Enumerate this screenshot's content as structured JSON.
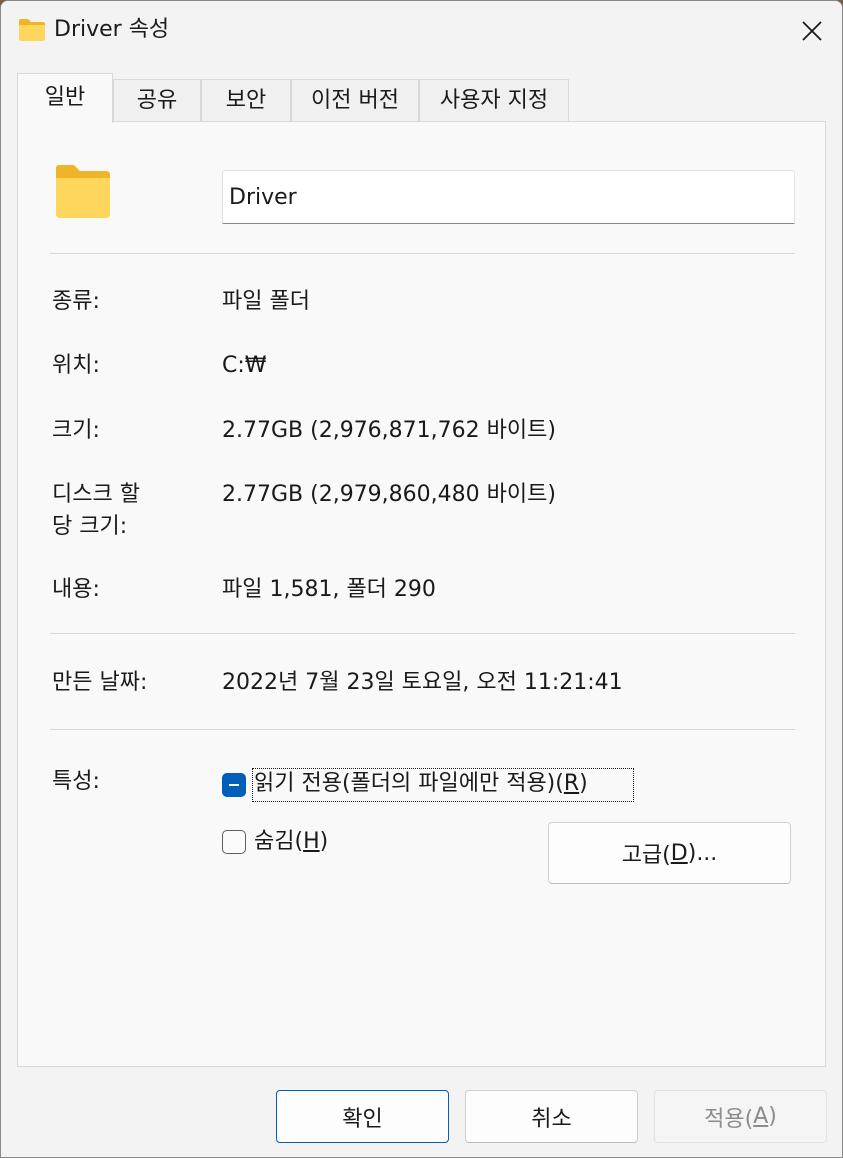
{
  "window": {
    "title": "Driver 속성",
    "title_icon": "folder-icon",
    "close_icon": "close-icon"
  },
  "tabs": [
    {
      "label": "일반",
      "active": true
    },
    {
      "label": "공유",
      "active": false
    },
    {
      "label": "보안",
      "active": false
    },
    {
      "label": "이전 버전",
      "active": false
    },
    {
      "label": "사용자 지정",
      "active": false
    }
  ],
  "general": {
    "folder_icon": "folder-icon",
    "name_value": "Driver",
    "rows": [
      {
        "label": "종류:",
        "value": "파일 폴더"
      },
      {
        "label": "위치:",
        "value": "C:₩"
      },
      {
        "label": "크기:",
        "value": "2.77GB (2,976,871,762 바이트)"
      },
      {
        "label_line1": "디스크 할",
        "label_line2": "당 크기:",
        "value": "2.77GB (2,979,860,480 바이트)"
      },
      {
        "label": "내용:",
        "value": "파일 1,581, 폴더 290"
      }
    ],
    "created": {
      "label": "만든 날짜:",
      "value": "2022년 7월 23일 토요일, 오전 11:21:41"
    },
    "attributes": {
      "label": "특성:",
      "readonly": {
        "text": "읽기 전용(폴더의 파일에만 적용)(",
        "mnemonic": "R",
        "suffix": ")",
        "state": "indeterminate"
      },
      "hidden": {
        "text": "숨김(",
        "mnemonic": "H",
        "suffix": ")",
        "state": "unchecked"
      },
      "advanced": {
        "text": "고급(",
        "mnemonic": "D",
        "suffix": ")..."
      }
    }
  },
  "footer": {
    "ok": "확인",
    "cancel": "취소",
    "apply": {
      "text": "적용(",
      "mnemonic": "A",
      "suffix": ")"
    }
  },
  "colors": {
    "accent": "#005fb8",
    "folder_front": "#ffd65c",
    "folder_back": "#f0b429"
  }
}
